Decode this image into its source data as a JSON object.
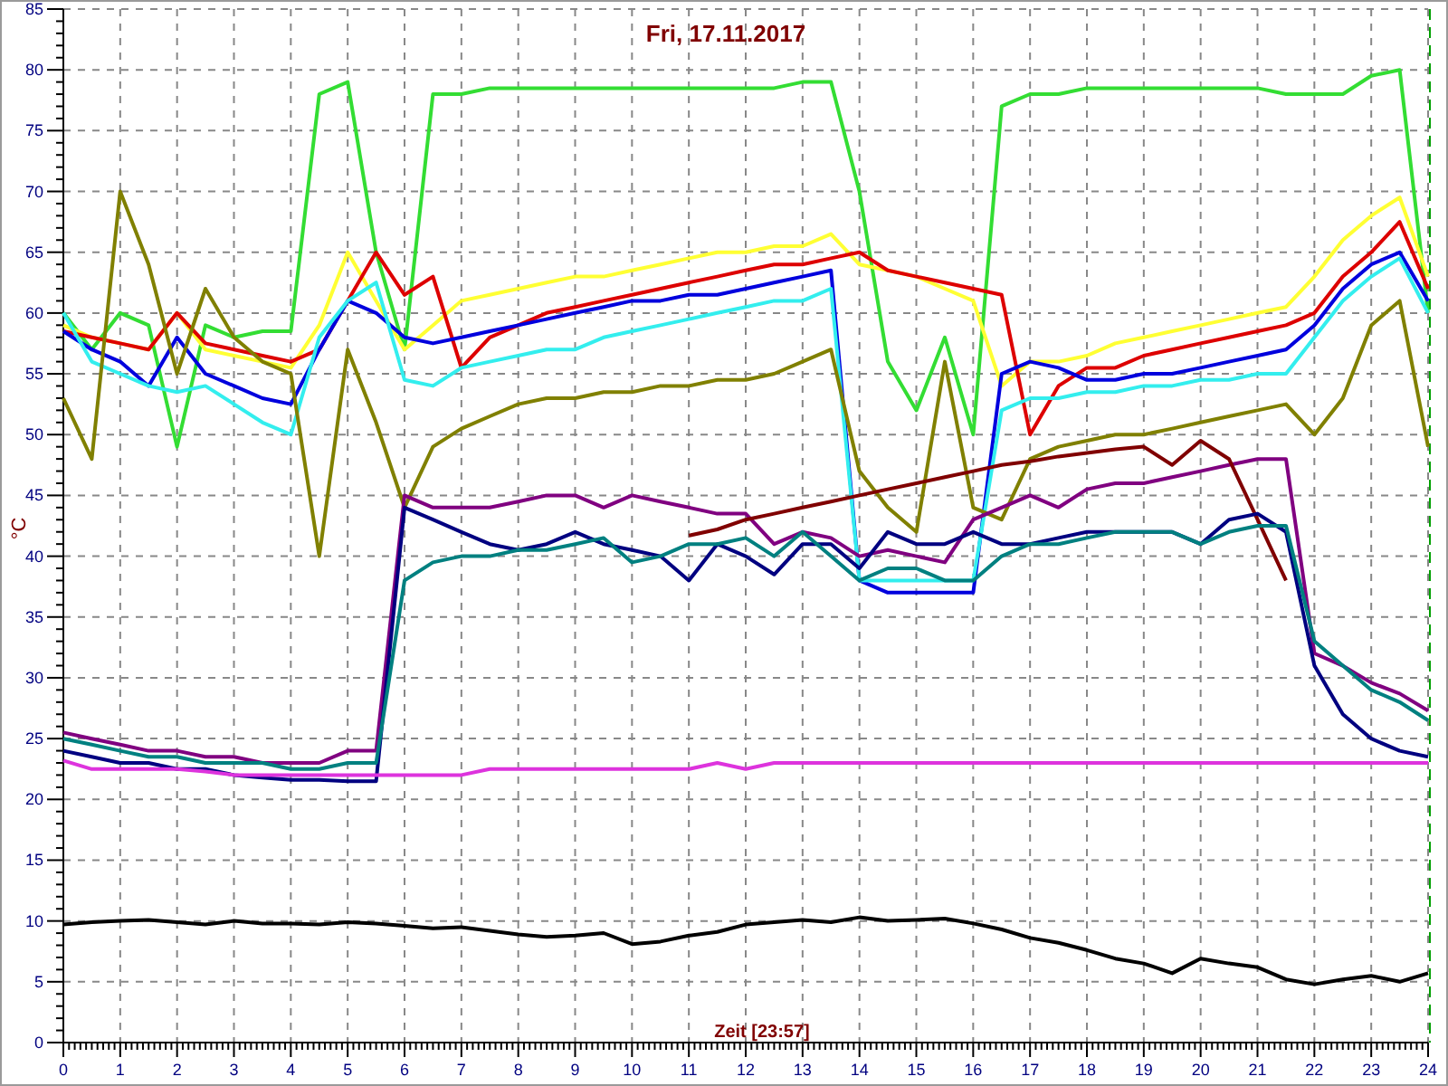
{
  "chart": {
    "chart_data": {
      "type": "line",
      "title": "Fri, 17.11.2017",
      "xlabel": "Zeit [23:57]",
      "ylabel": "°C",
      "x": [
        0,
        0.5,
        1,
        1.5,
        2,
        2.5,
        3,
        3.5,
        4,
        4.5,
        5,
        5.5,
        6,
        6.5,
        7,
        7.5,
        8,
        8.5,
        9,
        9.5,
        10,
        10.5,
        11,
        11.5,
        12,
        12.5,
        13,
        13.5,
        14,
        14.5,
        15,
        15.5,
        16,
        16.5,
        17,
        17.5,
        18,
        18.5,
        19,
        19.5,
        20,
        20.5,
        21,
        21.5,
        22,
        22.5,
        23,
        23.5,
        24
      ],
      "xlim": [
        0,
        24
      ],
      "ylim": [
        0,
        85
      ],
      "xticks": [
        0,
        1,
        2,
        3,
        4,
        5,
        6,
        7,
        8,
        9,
        10,
        11,
        12,
        13,
        14,
        15,
        16,
        17,
        18,
        19,
        20,
        21,
        22,
        23,
        24
      ],
      "yticks": [
        0,
        5,
        10,
        15,
        20,
        25,
        30,
        35,
        40,
        45,
        50,
        55,
        60,
        65,
        70,
        75,
        80,
        85
      ],
      "series": [
        {
          "color": "#33dd33",
          "values": [
            60,
            57,
            60,
            59,
            49,
            59,
            58,
            58.5,
            58.5,
            78,
            79,
            65,
            57,
            78,
            78,
            78.5,
            78.5,
            78.5,
            78.5,
            78.5,
            78.5,
            78.5,
            78.5,
            78.5,
            78.5,
            78.5,
            79,
            79,
            70,
            56,
            52,
            58,
            50,
            77,
            78,
            78,
            78.5,
            78.5,
            78.5,
            78.5,
            78.5,
            78.5,
            78.5,
            78,
            78,
            78,
            79.5,
            80,
            60
          ]
        },
        {
          "color": "#ffff33",
          "values": [
            59,
            58,
            57.5,
            57,
            60,
            57,
            56.5,
            56,
            55.5,
            59,
            65,
            61,
            57,
            59,
            61,
            61.5,
            62,
            62.5,
            63,
            63,
            63.5,
            64,
            64.5,
            65,
            65,
            65.5,
            65.5,
            66.5,
            64,
            63.5,
            63,
            62,
            61,
            54,
            56,
            56,
            56.5,
            57.5,
            58,
            58.5,
            59,
            59.5,
            60,
            60.5,
            63,
            66,
            68,
            69.5,
            63
          ]
        },
        {
          "color": "#dd0000",
          "values": [
            58.5,
            58,
            57.5,
            57,
            60,
            57.5,
            57,
            56.5,
            56,
            57,
            61,
            65,
            61.5,
            63,
            55.5,
            58,
            59,
            60,
            60.5,
            61,
            61.5,
            62,
            62.5,
            63,
            63.5,
            64,
            64,
            64.5,
            65,
            63.5,
            63,
            62.5,
            62,
            61.5,
            50,
            54,
            55.5,
            55.5,
            56.5,
            57,
            57.5,
            58,
            58.5,
            59,
            60,
            63,
            65,
            67.5,
            62
          ]
        },
        {
          "color": "#0000dd",
          "values": [
            58.5,
            57,
            56,
            54,
            58,
            55,
            54,
            53,
            52.5,
            57,
            61,
            60,
            58,
            57.5,
            58,
            58.5,
            59,
            59.5,
            60,
            60.5,
            61,
            61,
            61.5,
            61.5,
            62,
            62.5,
            63,
            63.5,
            38,
            37,
            37,
            37,
            37,
            55,
            56,
            55.5,
            54.5,
            54.5,
            55,
            55,
            55.5,
            56,
            56.5,
            57,
            59,
            62,
            64,
            65,
            61
          ]
        },
        {
          "color": "#33eeee",
          "values": [
            60,
            56,
            55,
            54,
            53.5,
            54,
            52.5,
            51,
            50,
            58,
            61,
            62.5,
            54.5,
            54,
            55.5,
            56,
            56.5,
            57,
            57,
            58,
            58.5,
            59,
            59.5,
            60,
            60.5,
            61,
            61,
            62,
            38,
            38,
            38,
            38,
            38,
            52,
            53,
            53,
            53.5,
            53.5,
            54,
            54,
            54.5,
            54.5,
            55,
            55,
            58,
            61,
            63,
            64.5,
            60
          ]
        },
        {
          "color": "#808000",
          "values": [
            53,
            48,
            70,
            64,
            55,
            62,
            58,
            56,
            55,
            40,
            57,
            51,
            44,
            49,
            50.5,
            51.5,
            52.5,
            53,
            53,
            53.5,
            53.5,
            54,
            54,
            54.5,
            54.5,
            55,
            56,
            57,
            47,
            44,
            42,
            56,
            44,
            43,
            48,
            49,
            49.5,
            50,
            50,
            50.5,
            51,
            51.5,
            52,
            52.5,
            50,
            53,
            59,
            61,
            49
          ]
        },
        {
          "color": "#800080",
          "values": [
            25.5,
            25,
            24.5,
            24,
            24,
            23.5,
            23.5,
            23,
            23,
            23,
            24,
            24,
            45,
            44,
            44,
            44,
            44.5,
            45,
            45,
            44,
            45,
            44.5,
            44,
            43.5,
            43.5,
            41,
            42,
            41.5,
            40,
            40.5,
            40,
            39.5,
            43,
            44,
            45,
            44,
            45.5,
            46,
            46,
            46.5,
            47,
            47.5,
            48,
            48,
            32,
            31,
            29.6,
            28.7,
            27.3
          ]
        },
        {
          "color": "#800000",
          "values": [
            null,
            null,
            null,
            null,
            null,
            null,
            null,
            null,
            null,
            null,
            null,
            null,
            null,
            null,
            null,
            null,
            null,
            null,
            null,
            null,
            null,
            null,
            41.7,
            42.2,
            43,
            43.5,
            44,
            44.5,
            45,
            45.5,
            46,
            46.5,
            47,
            47.5,
            47.8,
            48.2,
            48.5,
            48.8,
            49,
            47.5,
            49.5,
            48,
            43,
            38,
            null,
            null,
            null,
            null,
            null
          ]
        },
        {
          "color": "#000080",
          "values": [
            24,
            23.5,
            23,
            23,
            22.5,
            22.5,
            22,
            21.8,
            21.6,
            21.6,
            21.5,
            21.5,
            44,
            43,
            42,
            41,
            40.5,
            41,
            42,
            41,
            40.5,
            40,
            38,
            41,
            40,
            38.5,
            41,
            41,
            39,
            42,
            41,
            41,
            42,
            41,
            41,
            41.5,
            42,
            42,
            42,
            42,
            41,
            43,
            43.5,
            42,
            31,
            27,
            25,
            24,
            23.5
          ]
        },
        {
          "color": "#008080",
          "values": [
            25,
            24.5,
            24,
            23.5,
            23.5,
            23,
            23,
            23,
            22.5,
            22.5,
            23,
            23,
            38,
            39.5,
            40,
            40,
            40.5,
            40.5,
            41,
            41.5,
            39.5,
            40,
            41,
            41,
            41.5,
            40,
            42,
            40,
            38,
            39,
            39,
            38,
            38,
            40,
            41,
            41,
            41.5,
            42,
            42,
            42,
            41,
            42,
            42.5,
            42.5,
            33,
            31,
            29,
            28,
            26.5
          ]
        },
        {
          "color": "#dd33dd",
          "values": [
            23.2,
            22.5,
            22.5,
            22.5,
            22.5,
            22.3,
            22,
            22,
            22,
            22,
            22,
            22,
            22,
            22,
            22,
            22.5,
            22.5,
            22.5,
            22.5,
            22.5,
            22.5,
            22.5,
            22.5,
            23,
            22.5,
            23,
            23,
            23,
            23,
            23,
            23,
            23,
            23,
            23,
            23,
            23,
            23,
            23,
            23,
            23,
            23,
            23,
            23,
            23,
            23,
            23,
            23,
            23,
            23
          ]
        },
        {
          "color": "#000000",
          "values": [
            9.7,
            9.9,
            10,
            10.1,
            9.9,
            9.7,
            10,
            9.8,
            9.8,
            9.7,
            9.9,
            9.8,
            9.6,
            9.4,
            9.5,
            9.2,
            8.9,
            8.7,
            8.8,
            9,
            8.1,
            8.3,
            8.8,
            9.1,
            9.7,
            9.9,
            10.1,
            9.9,
            10.3,
            10,
            10.1,
            10.2,
            9.8,
            9.3,
            8.6,
            8.2,
            7.6,
            6.9,
            6.5,
            5.7,
            6.9,
            6.5,
            6.2,
            5.2,
            4.8,
            5.2,
            5.5,
            5,
            5.7
          ]
        }
      ],
      "grid": true
    }
  }
}
